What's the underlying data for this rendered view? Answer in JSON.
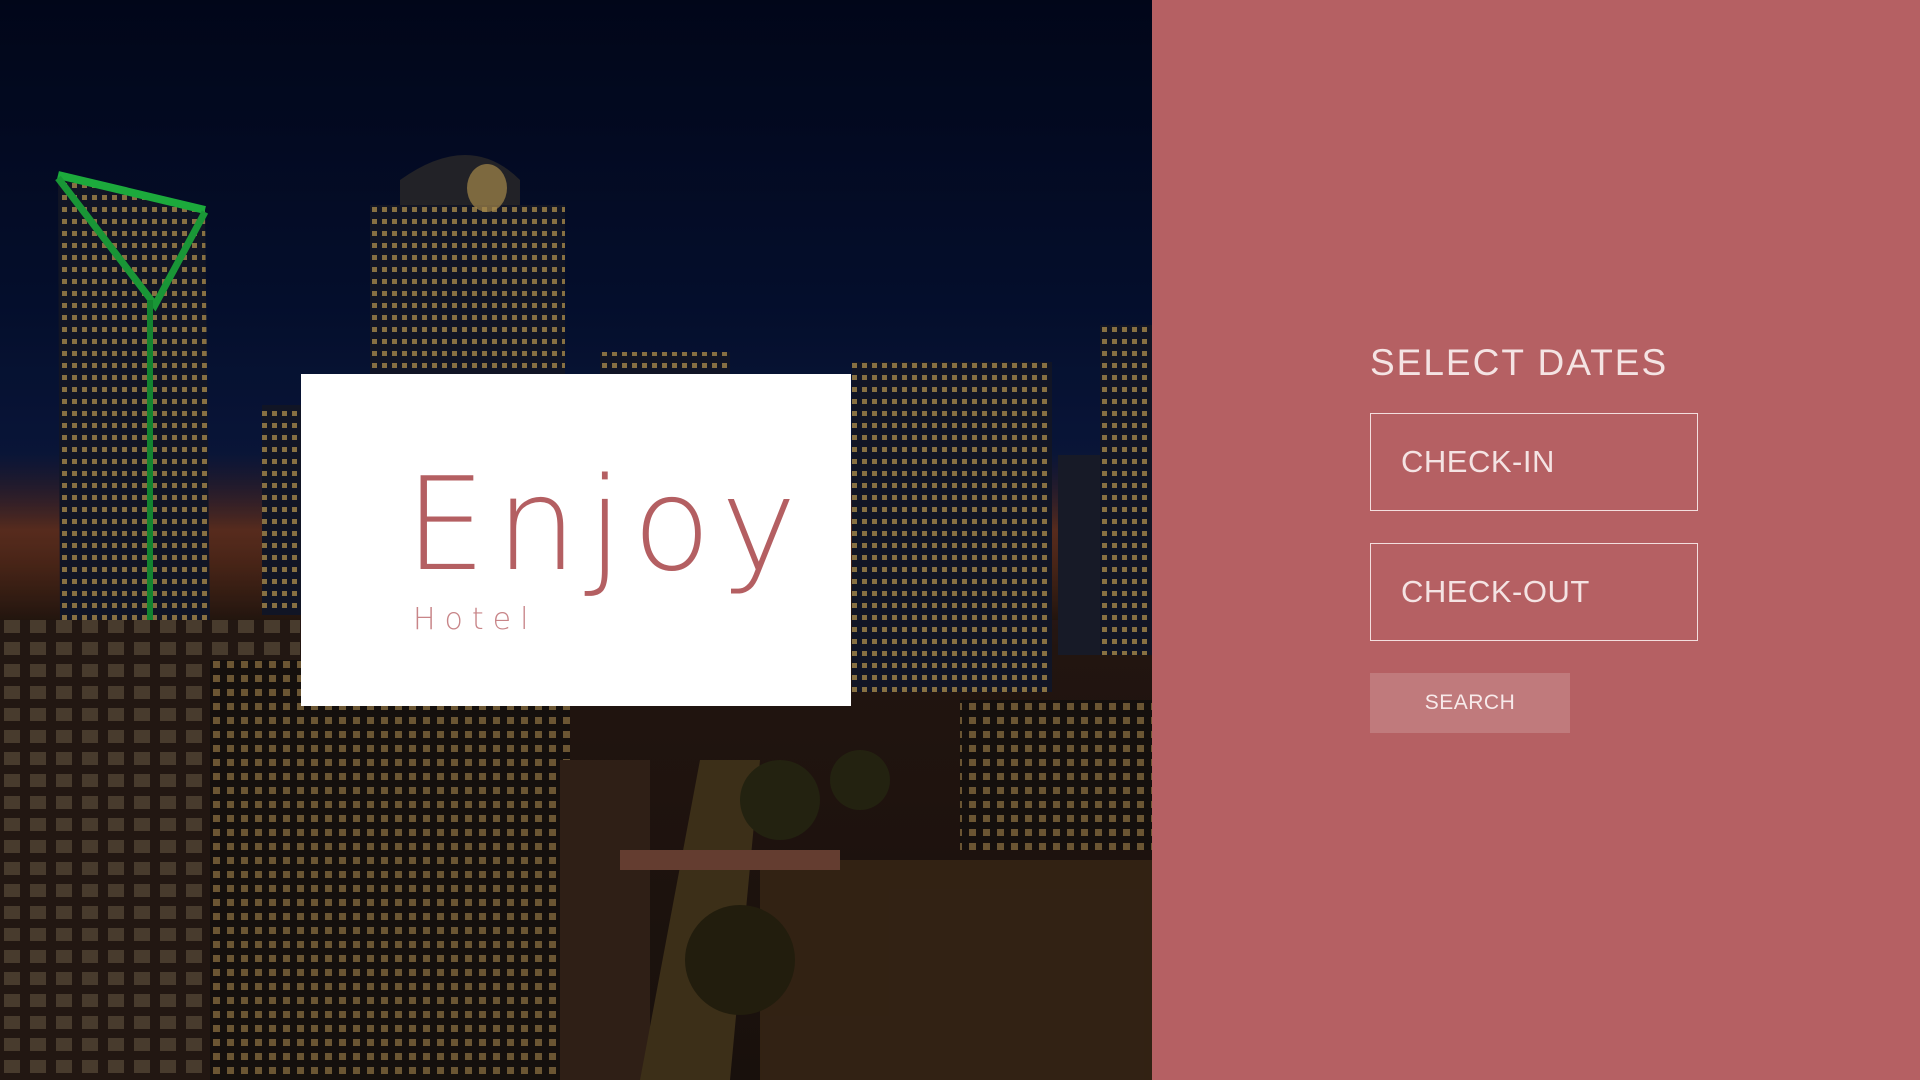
{
  "hero": {
    "image_alt": "city skyline at night",
    "brand": {
      "title": "Enjoy",
      "subtitle": "Hotel"
    }
  },
  "booking": {
    "heading": "SELECT DATES",
    "check_in_label": "CHECK-IN",
    "check_out_label": "CHECK-OUT",
    "search_label": "SEARCH"
  },
  "colors": {
    "accent": "#b56063",
    "brand_text": "#b45f62",
    "card_bg": "#ffffff",
    "button_bg": "#c07a7c"
  }
}
